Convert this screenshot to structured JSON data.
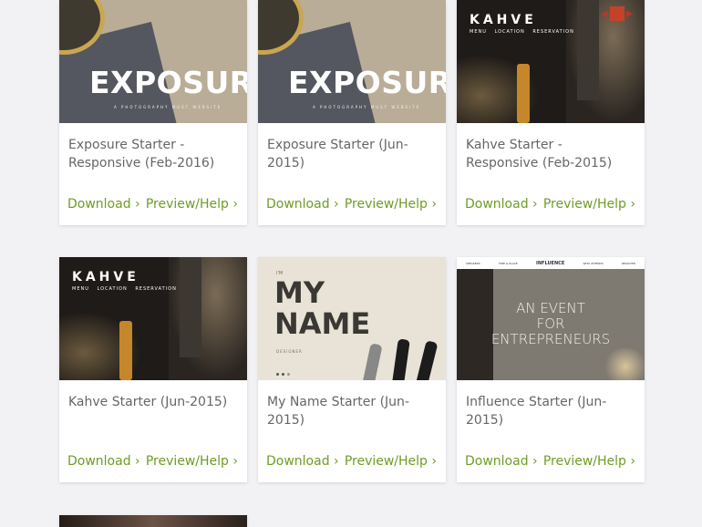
{
  "colors": {
    "background": "#f2f1f3",
    "card": "#ffffff",
    "link": "#6f9c25",
    "title": "#666666"
  },
  "cards": [
    {
      "title": "Exposure Starter - Responsive (Feb-2016)",
      "download": "Download ›",
      "preview": "Preview/Help ›",
      "thumb": {
        "word": "EXPOSURE",
        "sub": "A PHOTOGRAPHY MUST WEBSITE"
      }
    },
    {
      "title": "Exposure Starter (Jun-2015)",
      "download": "Download ›",
      "preview": "Preview/Help ›",
      "thumb": {
        "word": "EXPOSURE",
        "sub": "A PHOTOGRAPHY MUST WEBSITE"
      }
    },
    {
      "title": "Kahve Starter - Responsive (Feb-2015)",
      "download": "Download ›",
      "preview": "Preview/Help ›",
      "thumb": {
        "logo": "KAHVE",
        "menu": "MENU LOCATION RESERVATION"
      }
    },
    {
      "title": "Kahve Starter (Jun-2015)",
      "download": "Download ›",
      "preview": "Preview/Help ›",
      "thumb": {
        "logo": "KAHVE",
        "menu": "MENU LOCATION RESERVATION"
      }
    },
    {
      "title": "My Name Starter (Jun-2015)",
      "download": "Download ›",
      "preview": "Preview/Help ›",
      "thumb": {
        "im": "I'M",
        "line1": "MY",
        "line2": "NAME",
        "role": "DESIGNER"
      }
    },
    {
      "title": "Influence Starter (Jun-2015)",
      "download": "Download ›",
      "preview": "Preview/Help ›",
      "thumb": {
        "nav": [
          "SPEAKERS",
          "TIME & PLACE",
          "INFLUENCE",
          "WHO ATTENDS",
          "REGISTER"
        ],
        "line1": "AN EVENT",
        "line2": "FOR",
        "line3": "ENTREPRENEURS"
      }
    }
  ]
}
